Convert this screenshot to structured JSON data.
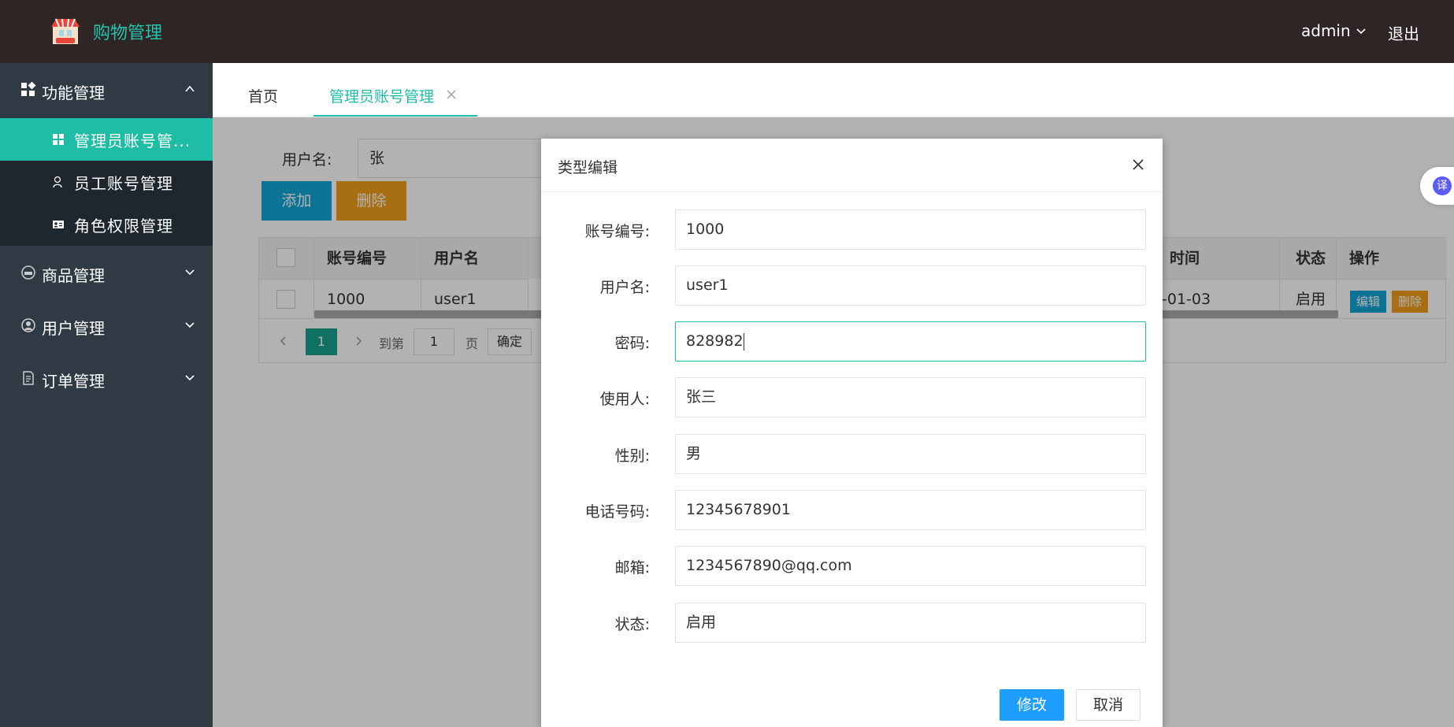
{
  "header": {
    "brand": "购物管理",
    "user": "admin",
    "logout": "退出"
  },
  "sidebar": {
    "groups": [
      {
        "label": "功能管理",
        "icon": "grid-icon",
        "expanded": true,
        "items": [
          {
            "label": "管理员账号管...",
            "icon": "grid-icon",
            "active": true
          },
          {
            "label": "员工账号管理",
            "icon": "user-icon"
          },
          {
            "label": "角色权限管理",
            "icon": "id-card-icon"
          }
        ]
      },
      {
        "label": "商品管理",
        "icon": "product-icon"
      },
      {
        "label": "用户管理",
        "icon": "user-circle-icon"
      },
      {
        "label": "订单管理",
        "icon": "document-icon"
      }
    ]
  },
  "tabs": [
    {
      "label": "首页"
    },
    {
      "label": "管理员账号管理",
      "active": true
    }
  ],
  "search": {
    "label": "用户名:",
    "value": "张"
  },
  "toolbar": {
    "add": "添加",
    "delete": "删除"
  },
  "table": {
    "columns": [
      "账号编号",
      "用户名",
      "时间",
      "状态",
      "操作"
    ],
    "rows": [
      {
        "id": "1000",
        "username": "user1",
        "time": "-01-03",
        "status": "启用",
        "edit": "编辑",
        "delete": "删除"
      }
    ]
  },
  "pager": {
    "current": "1",
    "goto_label": "到第",
    "goto_value": "1",
    "page_label": "页",
    "confirm": "确定"
  },
  "fab": {
    "label": "译"
  },
  "modal": {
    "title": "类型编辑",
    "fields": [
      {
        "label": "账号编号:",
        "value": "1000"
      },
      {
        "label": "用户名:",
        "value": "user1"
      },
      {
        "label": "密码:",
        "value": "828982",
        "focused": true
      },
      {
        "label": "使用人:",
        "value": "张三"
      },
      {
        "label": "性别:",
        "value": "男"
      },
      {
        "label": "电话号码:",
        "value": "12345678901"
      },
      {
        "label": "邮箱:",
        "value": "1234567890@qq.com"
      },
      {
        "label": "状态:",
        "value": "启用"
      }
    ],
    "submit": "修改",
    "cancel": "取消"
  },
  "colors": {
    "accent": "#1fbca6",
    "header_bg": "#302525",
    "sidebar_bg": "#2f3a45",
    "primary_blue": "#1e9fff",
    "warning": "#f0a019"
  }
}
